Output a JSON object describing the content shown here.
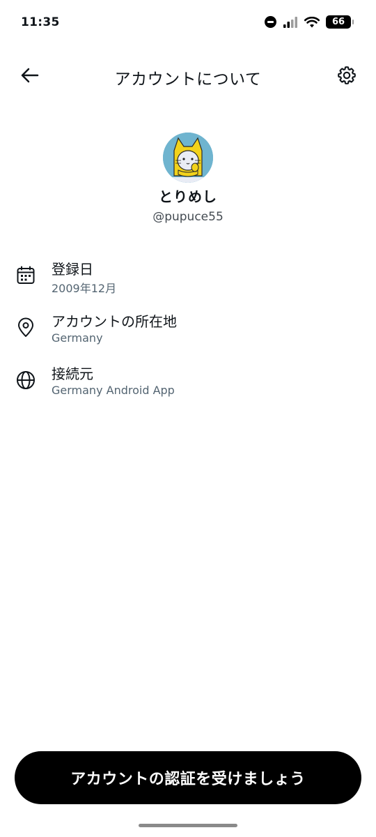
{
  "status_bar": {
    "time": "11:35",
    "battery_level": "66",
    "icons": [
      "do-not-disturb-icon",
      "signal-icon",
      "wifi-icon",
      "battery-icon"
    ]
  },
  "header": {
    "title": "アカウントについて",
    "back_icon": "arrow-left-icon",
    "settings_icon": "gear-icon"
  },
  "profile": {
    "display_name": "とりめし",
    "handle": "@pupuce55",
    "avatar_icon": "cat-avatar"
  },
  "info_items": [
    {
      "label": "登録日",
      "value": "2009年12月",
      "icon": "calendar-icon"
    },
    {
      "label": "アカウントの所在地",
      "value": "Germany",
      "icon": "location-pin-icon"
    },
    {
      "label": "接続元",
      "value": "Germany Android App",
      "icon": "globe-icon"
    }
  ],
  "verify_button": {
    "label": "アカウントの認証を受けましょう"
  },
  "colors": {
    "text_primary": "#0f1419",
    "text_secondary": "#536471",
    "button_bg": "#000000",
    "button_text": "#ffffff",
    "avatar_bg": "#6fb4cf",
    "avatar_hat": "#f2d21b"
  }
}
